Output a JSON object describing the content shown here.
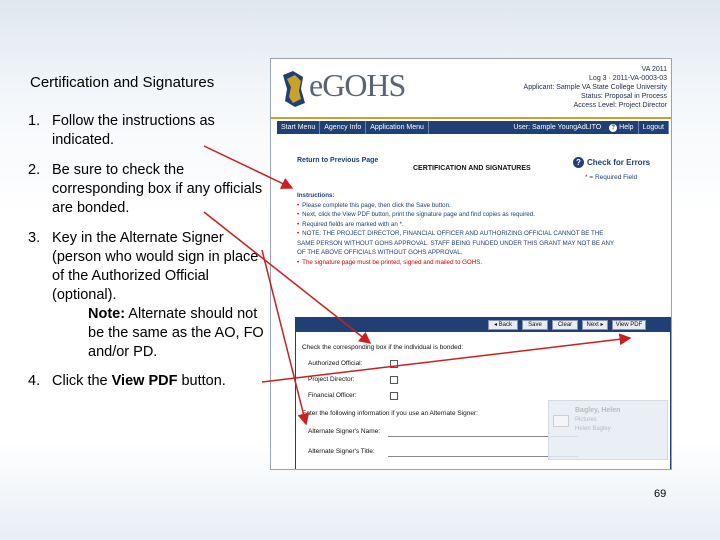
{
  "slide": {
    "title": "Certification and Signatures",
    "page_number": "69",
    "steps": [
      {
        "num": "1.",
        "text": "Follow the instructions as indicated."
      },
      {
        "num": "2.",
        "text": "Be sure to check the corresponding box if any officials are bonded."
      },
      {
        "num": "3.",
        "text": "Key in the Alternate Signer (person who would sign in place of the Authorized Official (optional).",
        "note_label": "Note:",
        "note_text": "Alternate should not be the same as the AO, FO and/or PD."
      },
      {
        "num": "4.",
        "text_pre": "Click the ",
        "text_bold": "View PDF",
        "text_post": " button."
      }
    ]
  },
  "app": {
    "logo_text": "eGOHS",
    "header_info": [
      "VA 2011",
      "Log 3 · 2011-VA-0003-03",
      "Applicant: Sample VA State College University",
      "Status: Proposal in Process",
      "Access Level: Project Director"
    ],
    "menu": [
      "Start Menu",
      "Agency Info",
      "Application Menu"
    ],
    "user": "User: Sample YoungAdLITO",
    "help_label": "Help",
    "logout_label": "Logout",
    "return_link": "Return to Previous Page",
    "page_title": "CERTIFICATION AND SIGNATURES",
    "check_errors": "Check for Errors",
    "required_note": "= Required Field",
    "instructions_title": "Instructions:",
    "instructions": [
      "Please complete this page, then click the Save button.",
      "Next, click the View PDF button, print the signature page and find copies as required.",
      "Required fields are marked with an *.",
      "NOTE: THE PROJECT DIRECTOR, FINANCIAL OFFICER AND AUTHORIZING OFFICIAL CANNOT BE THE",
      "SAME PERSON WITHOUT GOHS APPROVAL. STAFF BEING FUNDED UNDER THIS GRANT MAY NOT BE ANY",
      "OF THE ABOVE OFFICIALS WITHOUT GOHS APPROVAL.",
      "The signature page must be printed, signed and mailed to GOHS."
    ],
    "buttons": {
      "back": "◂ Back",
      "save": "Save",
      "clear": "Clear",
      "next": "Next ▸",
      "view_pdf": "View PDF"
    },
    "check_prompt": "Check the corresponding box if the individual is bonded:",
    "officials": [
      "Authorized Official:",
      "Project Director:",
      "Financial Officer:"
    ],
    "alternate_prompt": "Enter the following information if you use an Alternate Signer:",
    "alt_name_label": "Alternate Signer's Name:",
    "alt_title_label": "Alternate Signer's Title:"
  },
  "outlook_popup": {
    "sender": "Bagley, Helen",
    "line2": "Pictures",
    "line3": "Helen Bagley"
  },
  "colors": {
    "brand_navy": "#1f3f75",
    "brand_gold": "#c9a227",
    "arrow_red": "#cc1f1f"
  }
}
